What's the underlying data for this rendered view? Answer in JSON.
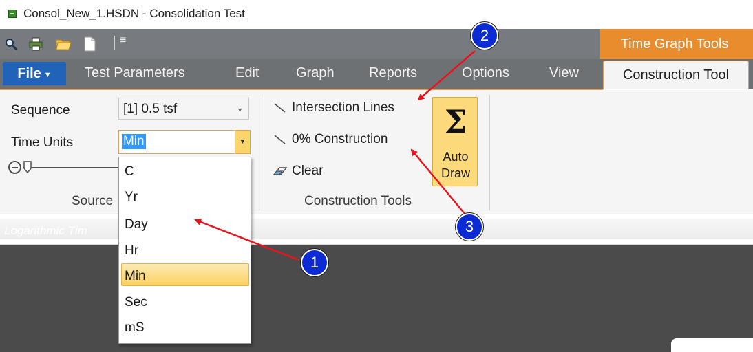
{
  "window": {
    "title": "Consol_New_1.HSDN - Consolidation Test",
    "app_icon": "green-app-icon"
  },
  "quick_access": {
    "icons": [
      "zoom-icon",
      "print-icon",
      "folder-open-icon",
      "new-document-icon"
    ],
    "more": "customize-dropdown-icon"
  },
  "ribbon_tabs": {
    "contextual_header": "Time Graph Tools",
    "file": "File",
    "items": [
      "Test Parameters",
      "Edit",
      "Graph",
      "Reports",
      "Options",
      "View"
    ],
    "active_contextual": "Construction Tool"
  },
  "source_group": {
    "sequence_label": "Sequence",
    "sequence_value": "[1]  0.5 tsf",
    "time_units_label": "Time Units",
    "time_units_value": "Min",
    "group_label": "Source"
  },
  "construction_group": {
    "intersection_lines": "Intersection Lines",
    "zero_construction": "0% Construction",
    "clear": "Clear",
    "auto_draw_line1": "Auto",
    "auto_draw_line2": "Draw",
    "group_label": "Construction Tools"
  },
  "time_units_dropdown": {
    "options": [
      "C",
      "Yr",
      "Day",
      "Hr",
      "Min",
      "Sec",
      "mS"
    ],
    "selected": "Min"
  },
  "graph": {
    "header_text": "Logarithmic Tim"
  },
  "callouts": [
    "1",
    "2",
    "3"
  ],
  "colors": {
    "accent_orange": "#e98c2e",
    "file_blue": "#2163b8",
    "callout_blue": "#0d2bd3",
    "arrow_red": "#e8141c",
    "highlight_yellow": "#fbd25f"
  }
}
